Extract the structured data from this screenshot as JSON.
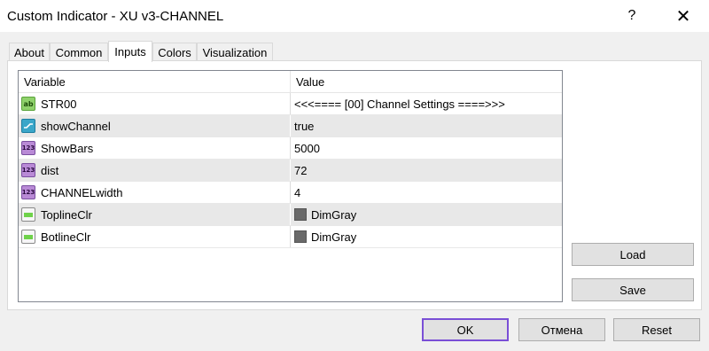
{
  "window": {
    "title": "Custom Indicator - XU v3-CHANNEL",
    "help_glyph": "?",
    "close_glyph": "✕"
  },
  "tabs": [
    {
      "label": "About",
      "active": false
    },
    {
      "label": "Common",
      "active": false
    },
    {
      "label": "Inputs",
      "active": true
    },
    {
      "label": "Colors",
      "active": false
    },
    {
      "label": "Visualization",
      "active": false
    }
  ],
  "grid": {
    "columns": {
      "variable": "Variable",
      "value": "Value"
    },
    "rows": [
      {
        "variable": "STR00",
        "value": "<<<==== [00] Channel Settings ====>>>",
        "icon": "string-icon",
        "icon_text": "ab"
      },
      {
        "variable": "showChannel",
        "value": "true",
        "icon": "bool-icon",
        "icon_text": ""
      },
      {
        "variable": "ShowBars",
        "value": "5000",
        "icon": "integer-icon",
        "icon_text": "123"
      },
      {
        "variable": "dist",
        "value": "72",
        "icon": "integer-icon",
        "icon_text": "123"
      },
      {
        "variable": "CHANNELwidth",
        "value": "4",
        "icon": "integer-icon",
        "icon_text": "123"
      },
      {
        "variable": "ToplineClr",
        "value": "DimGray",
        "icon": "color-icon",
        "icon_text": "",
        "swatch": "#696969"
      },
      {
        "variable": "BotlineClr",
        "value": "DimGray",
        "icon": "color-icon",
        "icon_text": "",
        "swatch": "#696969"
      }
    ]
  },
  "side_buttons": {
    "load": "Load",
    "save": "Save"
  },
  "footer_buttons": {
    "ok": "OK",
    "cancel": "Отмена",
    "reset": "Reset"
  },
  "colors": {
    "accent": "#7a4fd6",
    "alt_row": "#e8e8e8"
  }
}
